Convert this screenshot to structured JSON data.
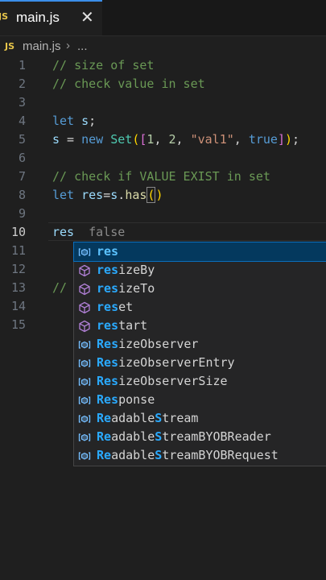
{
  "tab": {
    "badge": "JS",
    "title": "main.js",
    "close": "✕"
  },
  "breadcrumb": {
    "badge": "JS",
    "file": "main.js",
    "sep": "›",
    "more": "..."
  },
  "line_numbers": [
    "1",
    "2",
    "3",
    "4",
    "5",
    "6",
    "7",
    "8",
    "9",
    "10",
    "11",
    "12",
    "13",
    "14",
    "15"
  ],
  "code": {
    "l1": "// size of set",
    "l2": "// check value in set",
    "l4_kw": "let",
    "l4_var": "s",
    "l4_end": ";",
    "l5_var": "s",
    "l5_eq": " = ",
    "l5_new": "new",
    "l5_cls": "Set",
    "l5_p1": "(",
    "l5_b1": "[",
    "l5_n1": "1",
    "l5_c1": ", ",
    "l5_n2": "2",
    "l5_c2": ", ",
    "l5_str": "\"val1\"",
    "l5_c3": ", ",
    "l5_true": "true",
    "l5_b2": "]",
    "l5_p2": ")",
    "l5_semi": ";",
    "l7": "// check if VALUE EXIST in set",
    "l8_kw": "let",
    "l8_var": "res",
    "l8_eq": "=",
    "l8_obj": "s",
    "l8_dot": ".",
    "l8_fn": "has",
    "l8_p1": "(",
    "l8_p2": ")",
    "l10_var": "res",
    "l10_ghost": "false",
    "l13": "//"
  },
  "suggestions": [
    {
      "icon": "variable-icon",
      "hl": "res",
      "rest": "",
      "selected": true
    },
    {
      "icon": "method-icon",
      "hl": "res",
      "rest": "izeBy"
    },
    {
      "icon": "method-icon",
      "hl": "res",
      "rest": "izeTo"
    },
    {
      "icon": "method-icon",
      "hl": "res",
      "rest": "et",
      "mixed": [
        [
          "r",
          "1"
        ],
        [
          "e",
          "1"
        ],
        [
          "s",
          "1"
        ],
        [
          "et",
          "0"
        ]
      ]
    },
    {
      "icon": "method-icon",
      "hl": "res",
      "rest": "tart",
      "mixed": [
        [
          "res",
          "1"
        ],
        [
          "tart",
          "0"
        ]
      ]
    },
    {
      "icon": "variable-icon",
      "parts": [
        [
          "R",
          "1"
        ],
        [
          "e",
          "1"
        ],
        [
          "s",
          "1"
        ],
        [
          "izeObserver",
          "0"
        ]
      ]
    },
    {
      "icon": "variable-icon",
      "parts": [
        [
          "Res",
          "1"
        ],
        [
          "izeObserverEntry",
          "0"
        ]
      ]
    },
    {
      "icon": "variable-icon",
      "parts": [
        [
          "Res",
          "1"
        ],
        [
          "izeObserverSize",
          "0"
        ]
      ]
    },
    {
      "icon": "variable-icon",
      "parts": [
        [
          "Res",
          "1"
        ],
        [
          "ponse",
          "0"
        ]
      ]
    },
    {
      "icon": "variable-icon",
      "parts": [
        [
          "Re",
          "1"
        ],
        [
          "adable",
          "0"
        ],
        [
          "S",
          "1"
        ],
        [
          "tream",
          "0"
        ]
      ]
    },
    {
      "icon": "variable-icon",
      "parts": [
        [
          "Re",
          "1"
        ],
        [
          "adable",
          "0"
        ],
        [
          "S",
          "1"
        ],
        [
          "treamBYOBReader",
          "0"
        ]
      ]
    },
    {
      "icon": "variable-icon",
      "parts": [
        [
          "Re",
          "1"
        ],
        [
          "adable",
          "0"
        ],
        [
          "S",
          "1"
        ],
        [
          "treamBYOBRequest",
          "0"
        ]
      ]
    }
  ],
  "colors": {
    "accent": "#3b8eea",
    "selection": "#04395e",
    "highlight": "#2aaaff",
    "method_icon": "#b180d7",
    "variable_icon": "#75beff"
  }
}
